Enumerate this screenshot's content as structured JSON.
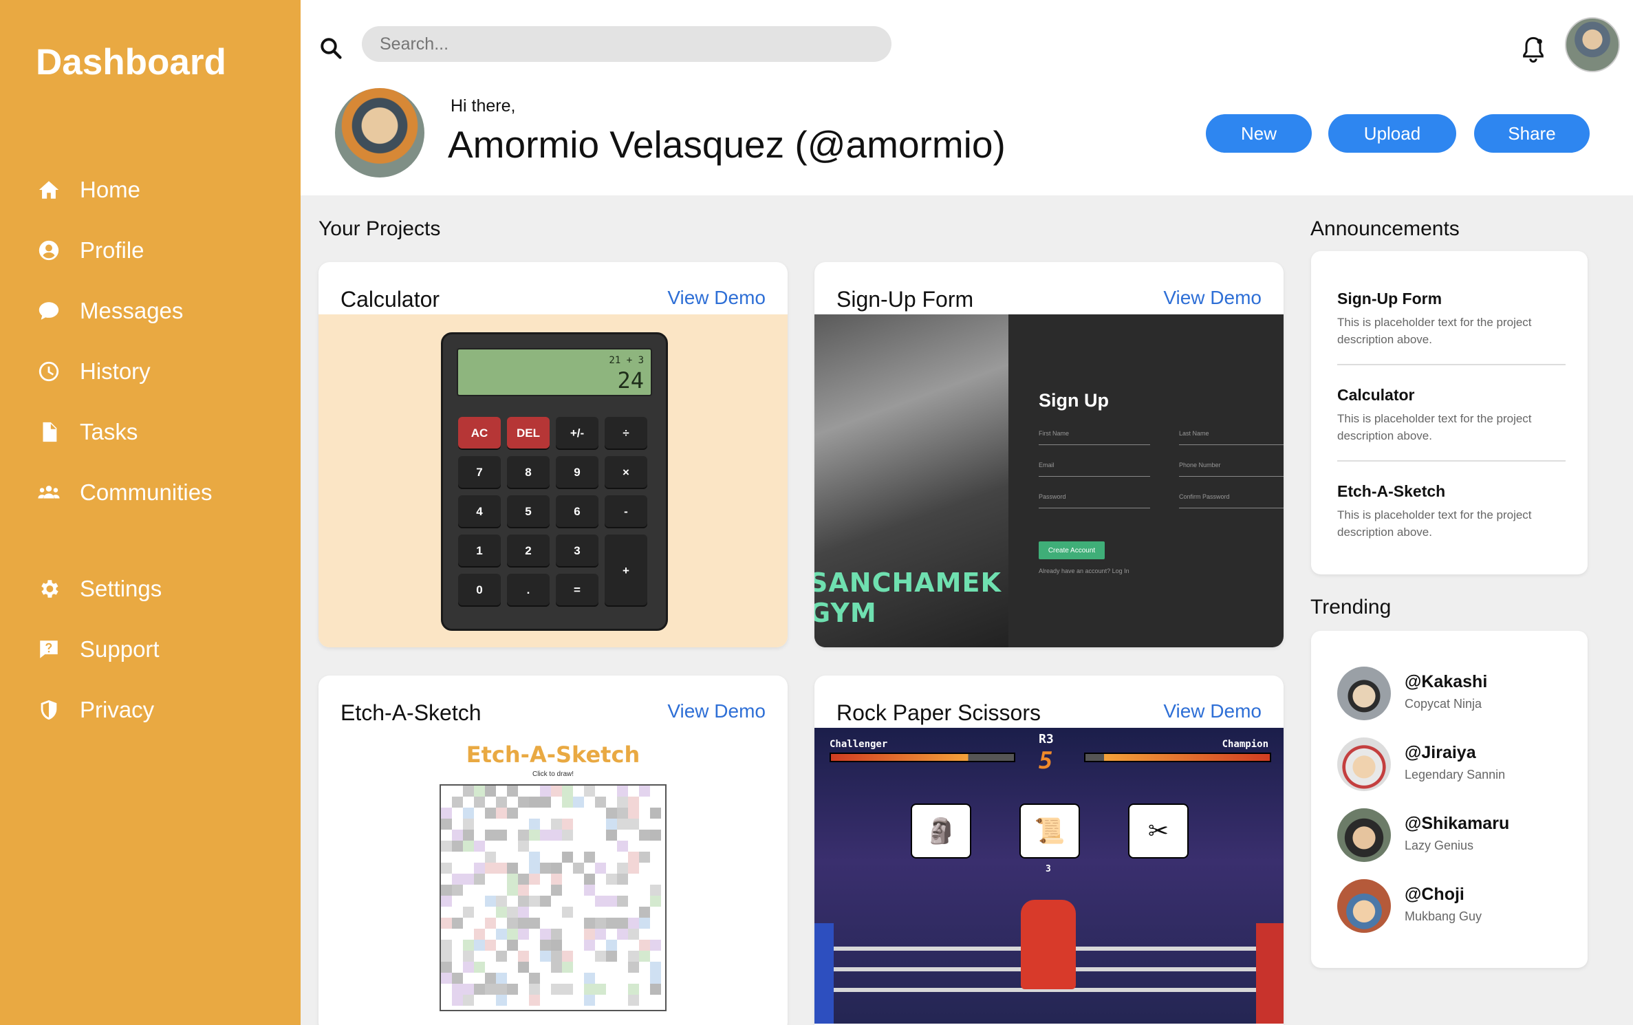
{
  "sidebar": {
    "title": "Dashboard",
    "items": [
      {
        "label": "Home",
        "icon": "home-icon"
      },
      {
        "label": "Profile",
        "icon": "user-circle-icon"
      },
      {
        "label": "Messages",
        "icon": "chat-bubble-icon"
      },
      {
        "label": "History",
        "icon": "clock-icon"
      },
      {
        "label": "Tasks",
        "icon": "document-icon"
      },
      {
        "label": "Communities",
        "icon": "users-icon"
      },
      {
        "label": "Settings",
        "icon": "gear-icon"
      },
      {
        "label": "Support",
        "icon": "help-icon"
      },
      {
        "label": "Privacy",
        "icon": "shield-icon"
      }
    ]
  },
  "header": {
    "search_placeholder": "Search...",
    "greeting": "Hi there,",
    "user_name": "Amormio Velasquez (@amormio)",
    "buttons": {
      "new": "New",
      "upload": "Upload",
      "share": "Share"
    }
  },
  "projects": {
    "title": "Your Projects",
    "link_label": "View Demo",
    "items": [
      {
        "name": "Calculator"
      },
      {
        "name": "Sign-Up Form"
      },
      {
        "name": "Etch-A-Sketch"
      },
      {
        "name": "Rock Paper Scissors"
      }
    ],
    "calculator": {
      "expression": "21 + 3",
      "result": "24",
      "keys": [
        "AC",
        "DEL",
        "+/-",
        "÷",
        "7",
        "8",
        "9",
        "×",
        "4",
        "5",
        "6",
        "-",
        "1",
        "2",
        "3",
        "+",
        "0",
        ".",
        "="
      ]
    },
    "signup": {
      "gym_name": "SANCHAMEK GYM",
      "heading": "Sign Up",
      "fields": [
        "First Name",
        "Last Name",
        "Email",
        "Phone Number",
        "Password",
        "Confirm Password"
      ],
      "create_button": "Create Account",
      "already": "Already have an account? Log In"
    },
    "etch": {
      "title": "Etch-A-Sketch",
      "subtitle": "Click to draw!"
    },
    "rps": {
      "left_name": "Challenger",
      "right_name": "Champion",
      "round_label": "R3",
      "round_number": "5",
      "score": "3"
    }
  },
  "announcements": {
    "title": "Announcements",
    "items": [
      {
        "title": "Sign-Up Form",
        "desc": "This is placeholder text for the project description above."
      },
      {
        "title": "Calculator",
        "desc": "This is placeholder text for the project description above."
      },
      {
        "title": "Etch-A-Sketch",
        "desc": "This is placeholder text for the project description above."
      }
    ]
  },
  "trending": {
    "title": "Trending",
    "items": [
      {
        "handle": "@Kakashi",
        "tag": "Copycat Ninja"
      },
      {
        "handle": "@Jiraiya",
        "tag": "Legendary Sannin"
      },
      {
        "handle": "@Shikamaru",
        "tag": "Lazy Genius"
      },
      {
        "handle": "@Choji",
        "tag": "Mukbang Guy"
      }
    ]
  },
  "colors": {
    "sidebar": "#e9a942",
    "accent": "#2e86f0",
    "link": "#2e6fd6"
  }
}
